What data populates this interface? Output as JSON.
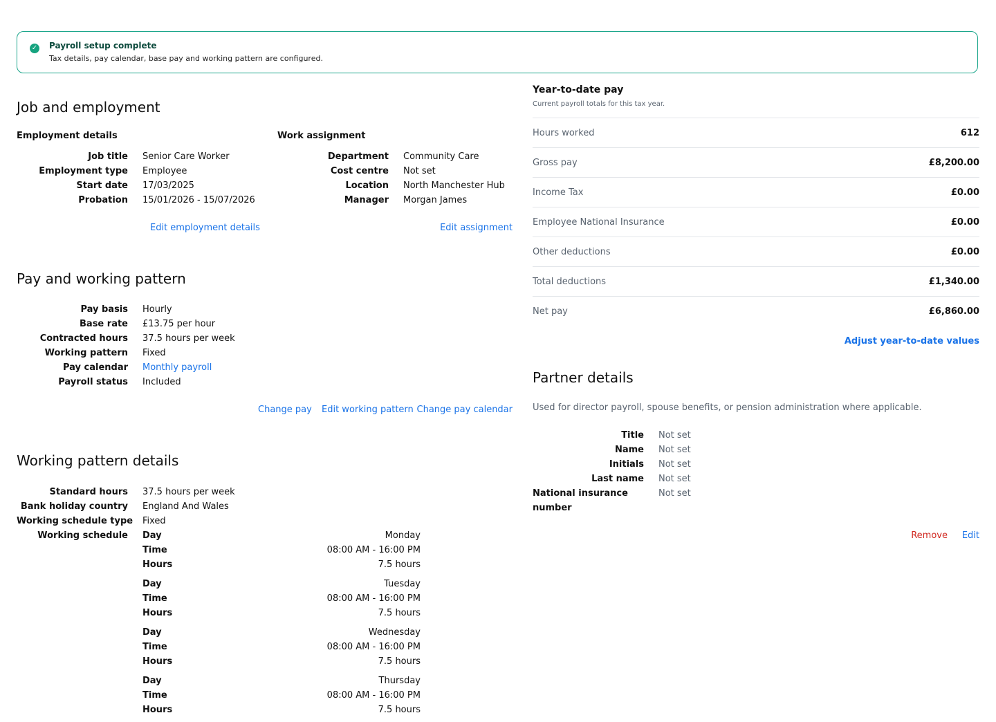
{
  "banner": {
    "icon": "check-circle-icon",
    "title": "Payroll setup complete",
    "text": "Tax details, pay calendar, base pay and working pattern are configured."
  },
  "job": {
    "heading": "Job and employment",
    "employment": {
      "heading": "Employment details",
      "rows": [
        {
          "k": "Job title",
          "v": "Senior Care Worker"
        },
        {
          "k": "Employment type",
          "v": "Employee"
        },
        {
          "k": "Start date",
          "v": "17/03/2025"
        },
        {
          "k": "Probation",
          "v": "15/01/2026 - 15/07/2026"
        }
      ],
      "edit_link": "Edit employment details"
    },
    "assignment": {
      "heading": "Work assignment",
      "rows": [
        {
          "k": "Department",
          "v": "Community Care"
        },
        {
          "k": "Cost centre",
          "v": "Not set"
        },
        {
          "k": "Location",
          "v": "North Manchester Hub"
        },
        {
          "k": "Manager",
          "v": "Morgan James"
        }
      ],
      "edit_link": "Edit assignment"
    }
  },
  "pay": {
    "heading": "Pay and working pattern",
    "rows": [
      {
        "k": "Pay basis",
        "v": "Hourly"
      },
      {
        "k": "Base rate",
        "v": "£13.75 per hour"
      },
      {
        "k": "Contracted hours",
        "v": "37.5 hours per week"
      },
      {
        "k": "Working pattern",
        "v": "Fixed"
      },
      {
        "k": "Pay calendar",
        "v": "Monthly payroll"
      },
      {
        "k": "Payroll status",
        "v": "Included"
      }
    ],
    "actions": {
      "change_pay": "Change pay",
      "edit_pattern": "Edit working pattern",
      "change_calendar": "Change pay calendar"
    }
  },
  "pattern": {
    "heading": "Working pattern details",
    "rows": [
      {
        "k": "Standard hours",
        "v": "37.5 hours per week"
      },
      {
        "k": "Bank holiday country",
        "v": "England And Wales"
      },
      {
        "k": "Working schedule type",
        "v": "Fixed"
      },
      {
        "k": "Working schedule",
        "v": ""
      }
    ],
    "labels": {
      "day": "Day",
      "time": "Time",
      "hours": "Hours"
    },
    "schedule": [
      {
        "day": "Monday",
        "time": "08:00 AM - 16:00 PM",
        "hours": "7.5 hours"
      },
      {
        "day": "Tuesday",
        "time": "08:00 AM - 16:00 PM",
        "hours": "7.5 hours"
      },
      {
        "day": "Wednesday",
        "time": "08:00 AM - 16:00 PM",
        "hours": "7.5 hours"
      },
      {
        "day": "Thursday",
        "time": "08:00 AM - 16:00 PM",
        "hours": "7.5 hours"
      }
    ]
  },
  "ytd": {
    "title": "Year-to-date pay",
    "subtitle": "Current payroll totals for this tax year.",
    "rows": [
      {
        "label": "Hours worked",
        "value": "612"
      },
      {
        "label": "Gross pay",
        "value": "£8,200.00"
      },
      {
        "label": "Income Tax",
        "value": "£0.00"
      },
      {
        "label": "Employee National Insurance",
        "value": "£0.00"
      },
      {
        "label": "Other deductions",
        "value": "£0.00"
      },
      {
        "label": "Total deductions",
        "value": "£1,340.00"
      },
      {
        "label": "Net pay",
        "value": "£6,860.00"
      }
    ],
    "adjust_link": "Adjust year-to-date values"
  },
  "partner": {
    "heading": "Partner details",
    "description": "Used for director payroll, spouse benefits, or pension administration where applicable.",
    "rows": [
      {
        "k": "Title",
        "v": "Not set"
      },
      {
        "k": "Name",
        "v": "Not set"
      },
      {
        "k": "Initials",
        "v": "Not set"
      },
      {
        "k": "Last name",
        "v": "Not set"
      },
      {
        "k": "National insurance",
        "v": "Not set"
      },
      {
        "k": "number",
        "v": ""
      }
    ],
    "remove": "Remove",
    "edit": "Edit"
  },
  "colors": {
    "accent": "#1a73e8",
    "success": "#16a37f",
    "danger": "#d0271f",
    "muted": "#5a6470"
  }
}
